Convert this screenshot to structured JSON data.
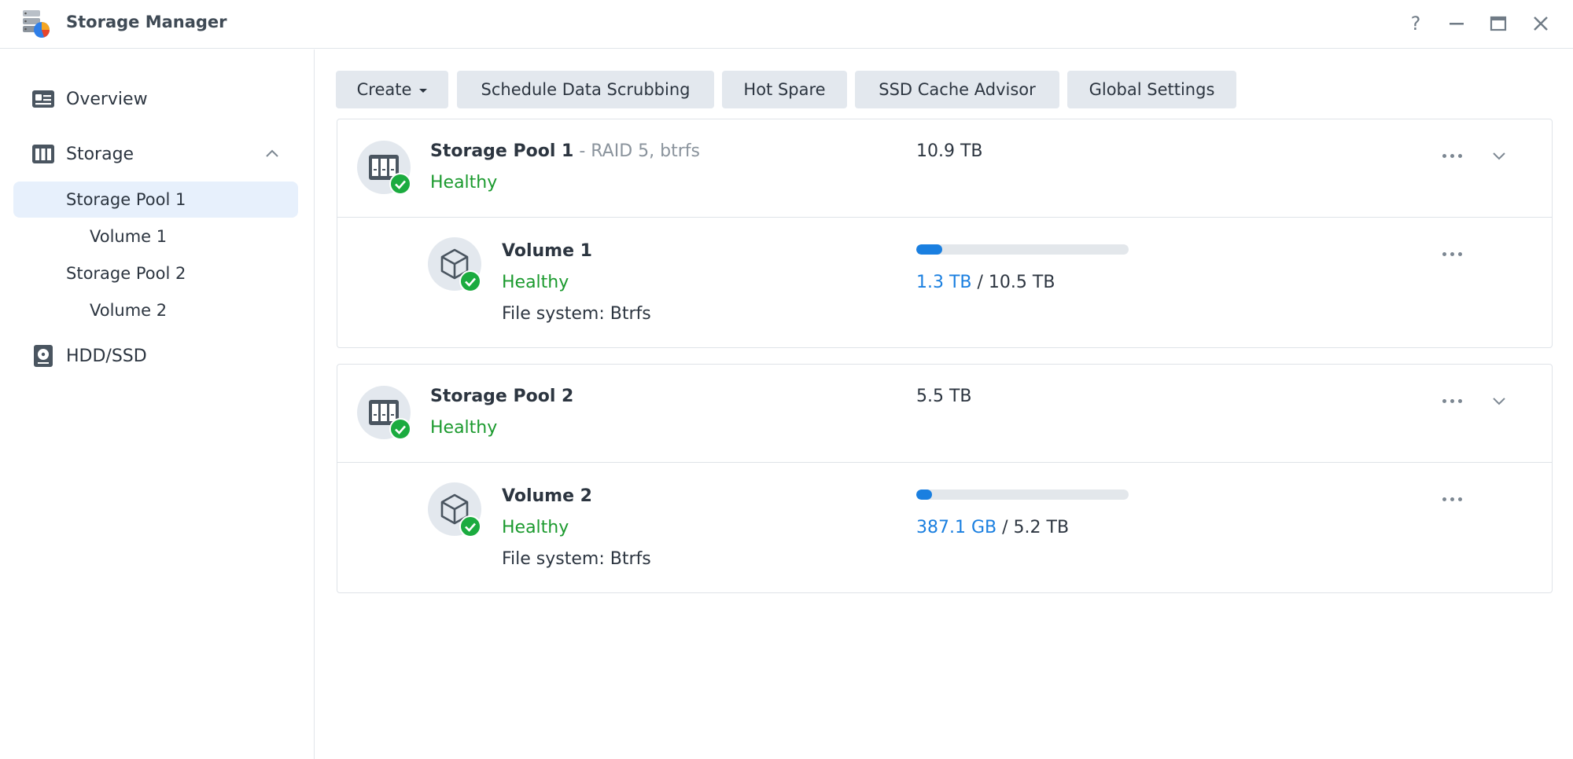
{
  "window": {
    "title": "Storage Manager",
    "help_glyph": "?"
  },
  "sidebar": {
    "overview_label": "Overview",
    "storage_label": "Storage",
    "storage_pool_1": "Storage Pool 1",
    "volume_1": "Volume 1",
    "storage_pool_2": "Storage Pool 2",
    "volume_2": "Volume 2",
    "hdd_label": "HDD/SSD"
  },
  "toolbar": {
    "create_label": "Create",
    "scrubbing_label": "Schedule Data Scrubbing",
    "hot_spare_label": "Hot Spare",
    "ssd_cache_label": "SSD Cache Advisor",
    "global_settings_label": "Global Settings"
  },
  "pools": [
    {
      "name": "Storage Pool 1",
      "detail": " - RAID 5, btrfs",
      "status": "Healthy",
      "size": "10.9 TB",
      "volume": {
        "name": "Volume 1",
        "status": "Healthy",
        "filesystem": "File system: Btrfs",
        "used": "1.3 TB",
        "separator": " / ",
        "total": "10.5 TB",
        "usage_fraction": 0.124
      }
    },
    {
      "name": "Storage Pool 2",
      "detail": "",
      "status": "Healthy",
      "size": "5.5 TB",
      "volume": {
        "name": "Volume 2",
        "status": "Healthy",
        "filesystem": "File system: Btrfs",
        "used": "387.1 GB",
        "separator": " / ",
        "total": "5.2 TB",
        "usage_fraction": 0.073
      }
    }
  ],
  "colors": {
    "accent_blue": "#1a7fe0",
    "healthy_green": "#1b9a2e",
    "badge_green": "#1bab3f",
    "selected_bg": "#e7f0fc"
  }
}
